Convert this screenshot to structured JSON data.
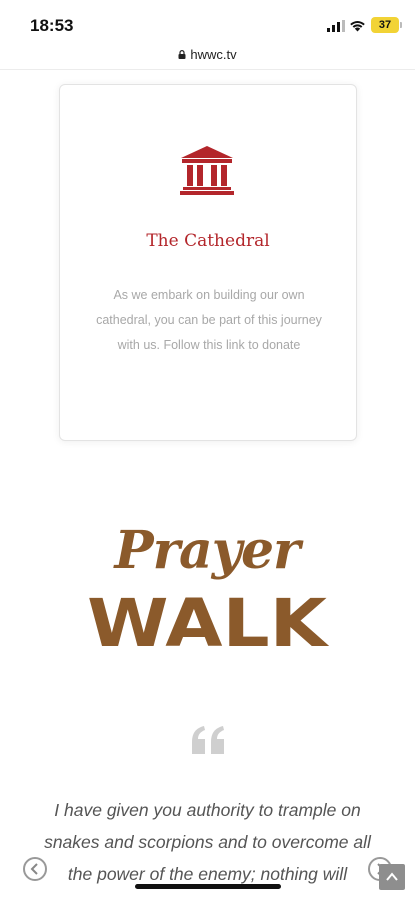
{
  "status_bar": {
    "time": "18:53",
    "battery": "37"
  },
  "browser": {
    "url": "hwwc.tv"
  },
  "card": {
    "icon": "cathedral-icon",
    "title": "The Cathedral",
    "text": "As we embark on building our own cathedral, you can be part of this journey with us. Follow this link to donate",
    "accent_color": "#b3262b"
  },
  "logo": {
    "script": "Prayer",
    "block": "WALK",
    "color": "#8b5a2b"
  },
  "quote": {
    "icon": "quote-icon",
    "text": "I have given you authority to trample on snakes and scorpions and to overcome all the power of the enemy; nothing will"
  },
  "carousel": {
    "prev_icon": "chevron-left-icon",
    "next_icon": "chevron-right-icon"
  },
  "scroll_top": {
    "icon": "chevron-up-icon"
  }
}
